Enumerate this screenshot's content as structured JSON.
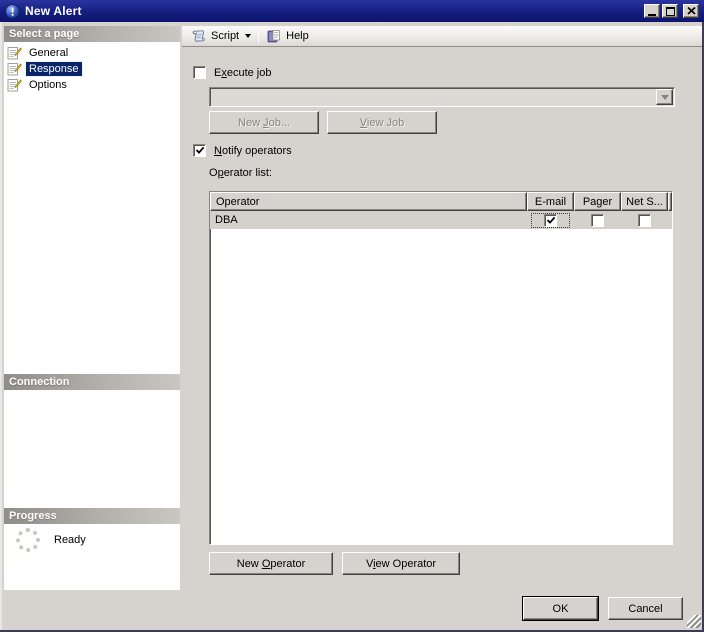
{
  "titlebar": {
    "title": "New Alert"
  },
  "sidebar": {
    "select_header": "Select a page",
    "items": [
      {
        "label": "General",
        "selected": false
      },
      {
        "label": "Response",
        "selected": true
      },
      {
        "label": "Options",
        "selected": false
      }
    ],
    "connection_header": "Connection",
    "progress_header": "Progress",
    "progress_status": "Ready"
  },
  "toolbar": {
    "script": "Script",
    "help": "Help"
  },
  "response": {
    "execute_job": {
      "pre": "E",
      "accel": "x",
      "post": "ecute job"
    },
    "execute_checked": false,
    "job_combo_value": "",
    "new_job": {
      "pre": "New ",
      "accel": "J",
      "post": "ob..."
    },
    "view_job": {
      "pre": "",
      "accel": "V",
      "post": "iew Job"
    },
    "notify_operators": {
      "pre": "",
      "accel": "N",
      "post": "otify operators"
    },
    "notify_checked": true,
    "operator_list": {
      "pre": "O",
      "accel": "p",
      "post": "erator list:"
    },
    "table": {
      "columns": [
        "Operator",
        "E-mail",
        "Pager",
        "Net S..."
      ],
      "rows": [
        {
          "operator": "DBA",
          "email": true,
          "pager": false,
          "netsend": false
        }
      ]
    },
    "new_operator": {
      "pre": "New ",
      "accel": "O",
      "post": "perator"
    },
    "view_operator": {
      "pre": "V",
      "accel": "i",
      "post": "ew Operator"
    }
  },
  "footer": {
    "ok": "OK",
    "cancel": "Cancel"
  },
  "icons": {
    "alert": "blue-circle-exclamation",
    "page": "document-with-pencil",
    "script": "scroll",
    "help": "book-page",
    "spinner": "dotted-ring",
    "minimize": "underscore-bar",
    "maximize": "box",
    "close": "x-cross",
    "dropdown": "down-triangle",
    "check": "checkmark",
    "resize_grip": "diagonal-lines"
  },
  "colors": {
    "titlebar_bg": "#141e7e",
    "selection_bg": "#0a246a",
    "face": "#d6d3ce",
    "disabled_text": "#87857e"
  }
}
